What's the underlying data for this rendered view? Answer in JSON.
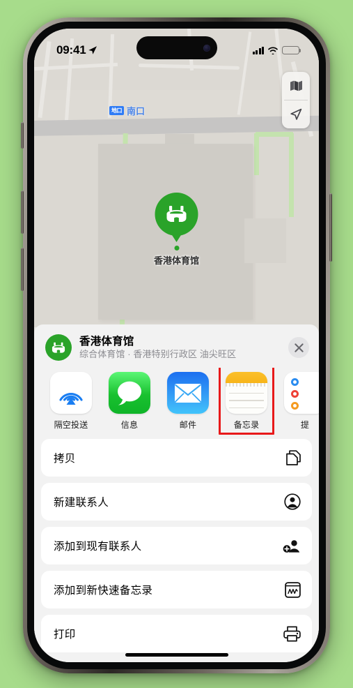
{
  "background_color": "#a7dc8b",
  "status_bar": {
    "time": "09:41",
    "location_arrow": "location-arrow-icon",
    "cellular": "cellular-signal-icon",
    "wifi": "wifi-icon",
    "battery": "battery-icon"
  },
  "map": {
    "metro_badge": "地口",
    "metro_label": "南口",
    "pin_label": "香港体育馆",
    "pin_color": "#2aa329",
    "controls": [
      {
        "name": "map-layers-button",
        "icon": "map-layers-icon"
      },
      {
        "name": "locate-me-button",
        "icon": "location-arrow-icon"
      }
    ]
  },
  "share_sheet": {
    "title": "香港体育馆",
    "subtitle": "综合体育馆 · 香港特别行政区 油尖旺区",
    "close_label": "✕",
    "apps": [
      {
        "label": "隔空投送",
        "icon": "airdrop-icon",
        "highlighted": false
      },
      {
        "label": "信息",
        "icon": "messages-icon",
        "highlighted": false
      },
      {
        "label": "邮件",
        "icon": "mail-icon",
        "highlighted": false
      },
      {
        "label": "备忘录",
        "icon": "notes-icon",
        "highlighted": true
      },
      {
        "label": "提",
        "icon": "reminders-icon",
        "highlighted": false
      }
    ],
    "actions": [
      {
        "label": "拷贝",
        "icon": "copy-icon"
      },
      {
        "label": "新建联系人",
        "icon": "new-contact-icon"
      },
      {
        "label": "添加到现有联系人",
        "icon": "add-to-contact-icon"
      },
      {
        "label": "添加到新快速备忘录",
        "icon": "quick-note-icon"
      },
      {
        "label": "打印",
        "icon": "printer-icon"
      }
    ],
    "highlight_color": "#e8191a"
  }
}
